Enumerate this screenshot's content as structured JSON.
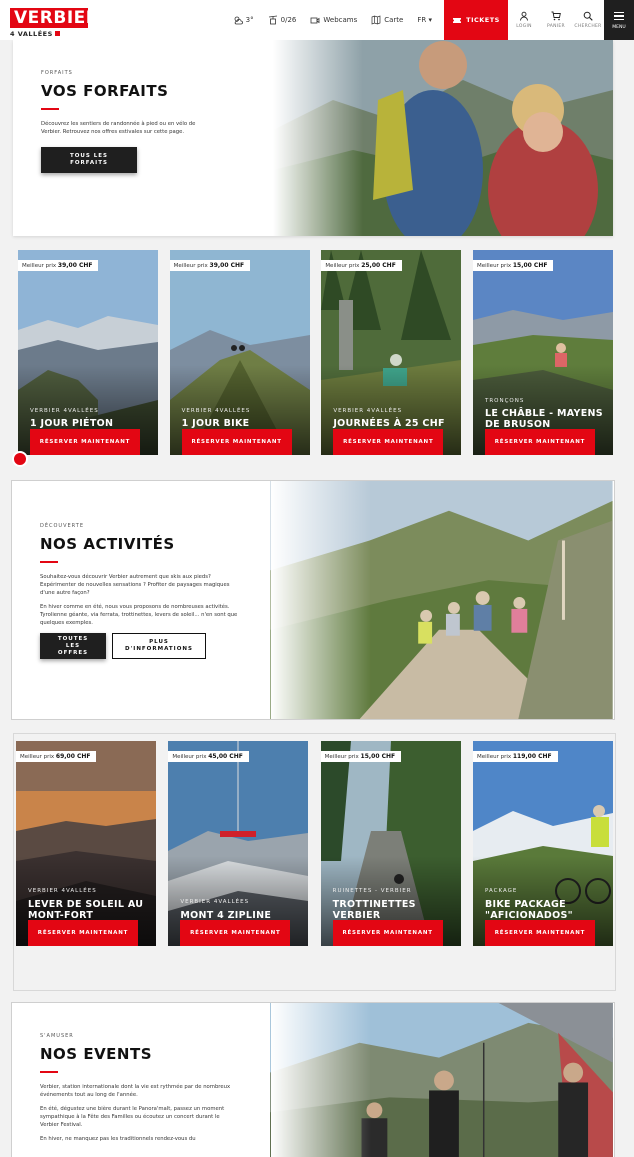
{
  "header": {
    "logo_brand": "VERBIER",
    "logo_sub": "4 VALLÉES",
    "weather": "3°",
    "lifts": "0/26",
    "webcams": "Webcams",
    "map": "Carte",
    "lang": "FR ▾",
    "tickets": "TICKETS",
    "login": "LOGIN",
    "cart": "PANIER",
    "search": "CHERCHER",
    "menu": "MENU"
  },
  "forfaits": {
    "eyebrow": "FORFAITS",
    "title": "VOS FORFAITS",
    "text": "Découvrez les sentiers de randonnée à pied ou en vélo de Verbier. Retrouvez nos offres estivales sur cette page.",
    "button": "TOUS LES FORFAITS"
  },
  "cards1": [
    {
      "price_label": "Meilleur prix",
      "price": "39,00 CHF",
      "kicker": "VERBIER 4VALLÉES",
      "title": "1 JOUR PIÉTON",
      "button": "RÉSERVER MAINTENANT"
    },
    {
      "price_label": "Meilleur prix",
      "price": "39,00 CHF",
      "kicker": "VERBIER 4VALLÉES",
      "title": "1 JOUR BIKE",
      "button": "RÉSERVER MAINTENANT"
    },
    {
      "price_label": "Meilleur prix",
      "price": "25,00 CHF",
      "kicker": "VERBIER 4VALLÉES",
      "title": "JOURNÉES À 25 CHF",
      "button": "RÉSERVER MAINTENANT"
    },
    {
      "price_label": "Meilleur prix",
      "price": "15,00 CHF",
      "kicker": "TRONÇONS",
      "title": "LE CHÂBLE - MAYENS DE BRUSON",
      "button": "RÉSERVER MAINTENANT"
    }
  ],
  "activites": {
    "eyebrow": "DÉCOUVERTE",
    "title": "NOS ACTIVITÉS",
    "text1": "Souhaitez-vous découvrir Verbier autrement que skis aux pieds? Expérimenter de nouvelles sensations ? Profiter de paysages magiques d'une autre façon?",
    "text2": "En hiver comme en été, nous vous proposons de nombreuses activités. Tyrolienne géante, via ferrata, trottinettes, levers de soleil... n'en sont que quelques exemples.",
    "button1": "TOUTES LES OFFRES",
    "button2": "PLUS D'INFORMATIONS"
  },
  "cards2": [
    {
      "price_label": "Meilleur prix",
      "price": "69,00 CHF",
      "kicker": "VERBIER 4VALLÉES",
      "title": "LEVER DE SOLEIL AU MONT-FORT",
      "button": "RÉSERVER MAINTENANT"
    },
    {
      "price_label": "Meilleur prix",
      "price": "45,00 CHF",
      "kicker": "VERBIER 4VALLÉES",
      "title": "MONT 4 ZIPLINE",
      "button": "RÉSERVER MAINTENANT"
    },
    {
      "price_label": "Meilleur prix",
      "price": "15,00 CHF",
      "kicker": "RUINETTES - VERBIER",
      "title": "TROTTINETTES VERBIER",
      "button": "RÉSERVER MAINTENANT"
    },
    {
      "price_label": "Meilleur prix",
      "price": "119,00 CHF",
      "kicker": "PACKAGE",
      "title": "BIKE PACKAGE \"AFICIONADOS\"",
      "button": "RÉSERVER MAINTENANT"
    }
  ],
  "events": {
    "eyebrow": "S'AMUSER",
    "title": "NOS EVENTS",
    "text1": "Verbier, station internationale dont la vie est rythmée par de nombreux événements tout au long de l'année.",
    "text2": "En été, dégustez une bière durant le Panora'malt, passez un moment sympathique à la Fête des Familles ou écoutez un concert durant le Verbier Festival.",
    "text3": "En hiver, ne manquez pas les traditionnels rendez-vous du"
  },
  "colors": {
    "accent": "#e30613",
    "dark": "#1f1f1f"
  }
}
